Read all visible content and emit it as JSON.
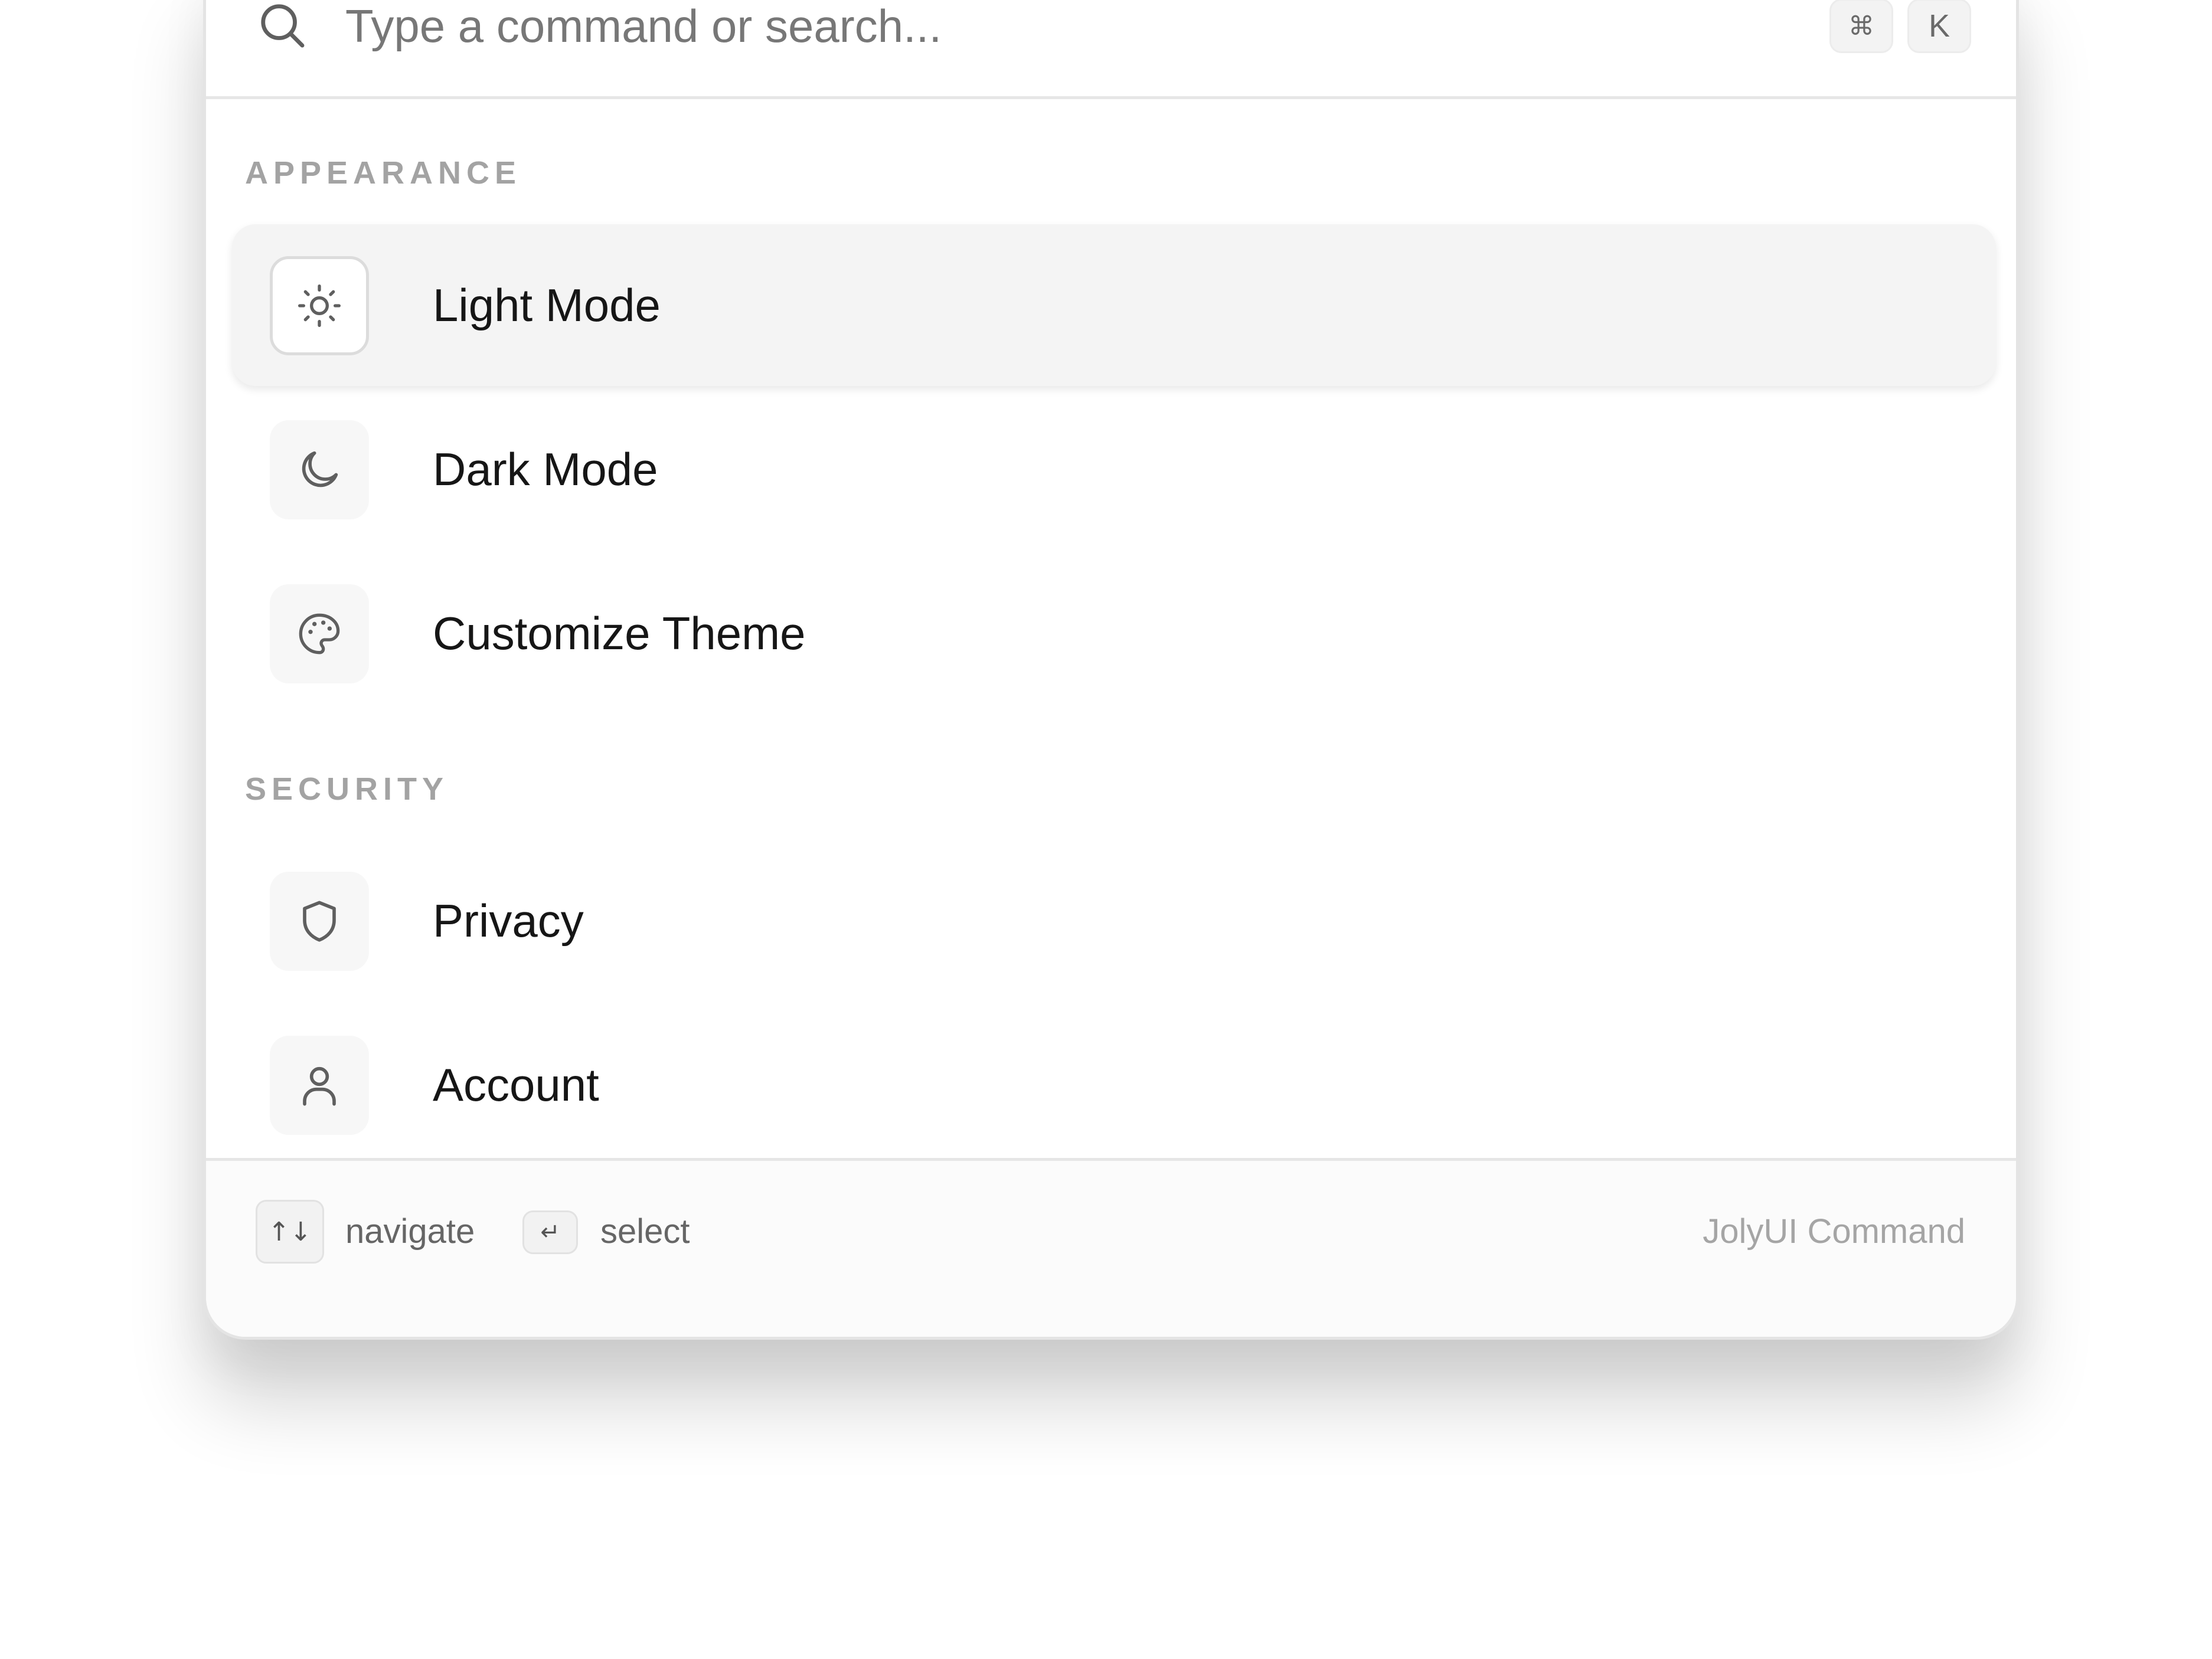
{
  "search": {
    "placeholder": "Type a command or search...",
    "icon": "search-icon",
    "shortcut_keys": [
      "⌘",
      "K"
    ]
  },
  "sections": [
    {
      "heading": "APPEARANCE",
      "items": [
        {
          "label": "Light Mode",
          "icon": "sun-icon",
          "selected": true
        },
        {
          "label": "Dark Mode",
          "icon": "moon-icon",
          "selected": false
        },
        {
          "label": "Customize Theme",
          "icon": "palette-icon",
          "selected": false
        }
      ]
    },
    {
      "heading": "SECURITY",
      "items": [
        {
          "label": "Privacy",
          "icon": "shield-icon",
          "selected": false
        },
        {
          "label": "Account",
          "icon": "user-icon",
          "selected": false
        }
      ]
    }
  ],
  "footer": {
    "navigate_key": "↑↓",
    "navigate_label": "navigate",
    "select_key": "↵",
    "select_label": "select",
    "brand": "JolyUI Command"
  },
  "colors": {
    "selected_row_bg": "#f4f4f4",
    "icon_stroke": "#5f5f5f",
    "heading_text": "#a3a3a3",
    "item_text": "#161616"
  }
}
